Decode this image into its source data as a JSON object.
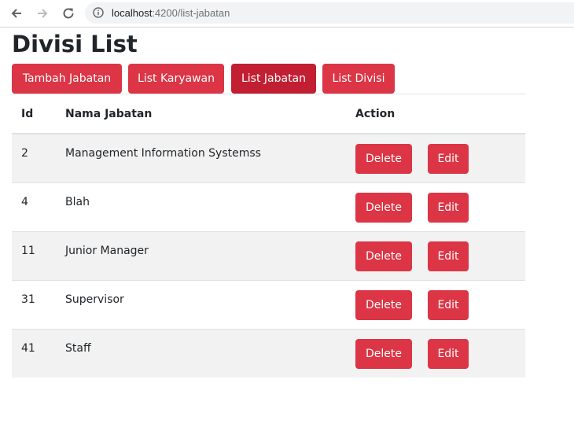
{
  "browser": {
    "url_host": "localhost",
    "url_rest": ":4200/list-jabatan"
  },
  "page": {
    "title": "Divisi List"
  },
  "nav_buttons": [
    {
      "label": "Tambah Jabatan",
      "active": false
    },
    {
      "label": "List Karyawan",
      "active": false
    },
    {
      "label": "List Jabatan",
      "active": true
    },
    {
      "label": "List Divisi",
      "active": false
    }
  ],
  "table": {
    "headers": [
      "Id",
      "Nama Jabatan",
      "Action"
    ],
    "rows": [
      {
        "id": "2",
        "name": "Management Information Systemss"
      },
      {
        "id": "4",
        "name": "Blah"
      },
      {
        "id": "11",
        "name": "Junior Manager"
      },
      {
        "id": "31",
        "name": "Supervisor"
      },
      {
        "id": "41",
        "name": "Staff"
      }
    ],
    "delete_label": "Delete",
    "edit_label": "Edit"
  },
  "colors": {
    "danger": "#dc3545",
    "danger_active": "#c21f32",
    "stripe": "#f2f2f2"
  }
}
